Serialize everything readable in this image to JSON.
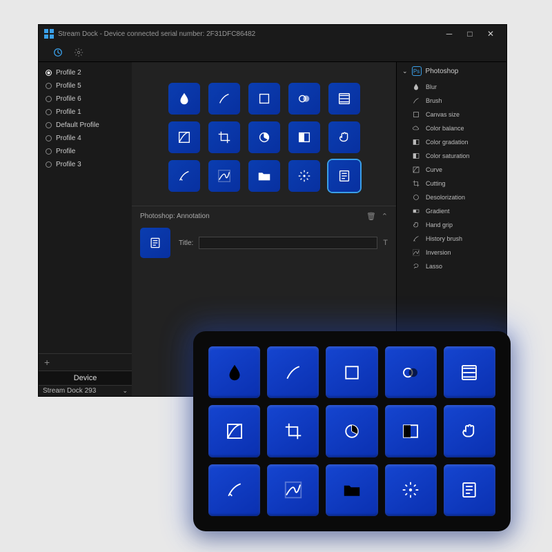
{
  "window": {
    "title": "Stream Dock - Device connected serial number: 2F31DFC86482"
  },
  "profiles": [
    {
      "label": "Profile 2",
      "selected": true
    },
    {
      "label": "Profile 5",
      "selected": false
    },
    {
      "label": "Profile 6",
      "selected": false
    },
    {
      "label": "Profile 1",
      "selected": false
    },
    {
      "label": "Default Profile",
      "selected": false
    },
    {
      "label": "Profile 4",
      "selected": false
    },
    {
      "label": "Profile",
      "selected": false
    },
    {
      "label": "Profile 3",
      "selected": false
    }
  ],
  "device_section": {
    "header": "Device",
    "selected": "Stream Dock 293"
  },
  "inspector": {
    "breadcrumb": "Photoshop: Annotation",
    "title_label": "Title:",
    "title_value": ""
  },
  "actions_panel": {
    "header": "Photoshop",
    "items": [
      {
        "label": "Blur",
        "icon": "drop"
      },
      {
        "label": "Brush",
        "icon": "brush"
      },
      {
        "label": "Canvas size",
        "icon": "rect"
      },
      {
        "label": "Color balance",
        "icon": "cloud"
      },
      {
        "label": "Color gradation",
        "icon": "split"
      },
      {
        "label": "Color saturation",
        "icon": "split"
      },
      {
        "label": "Curve",
        "icon": "curve"
      },
      {
        "label": "Cutting",
        "icon": "crop"
      },
      {
        "label": "Desolorization",
        "icon": "circle"
      },
      {
        "label": "Gradient",
        "icon": "gradient"
      },
      {
        "label": "Hand grip",
        "icon": "hand"
      },
      {
        "label": "History brush",
        "icon": "history"
      },
      {
        "label": "Inversion",
        "icon": "curve2"
      },
      {
        "label": "Lasso",
        "icon": "lasso"
      }
    ]
  },
  "key_icons": [
    "drop",
    "brush",
    "rect",
    "overlap",
    "list",
    "curve",
    "crop",
    "pie",
    "split",
    "hand",
    "history",
    "curve2",
    "folder",
    "wand",
    "note"
  ],
  "ps_badge": "Ps"
}
